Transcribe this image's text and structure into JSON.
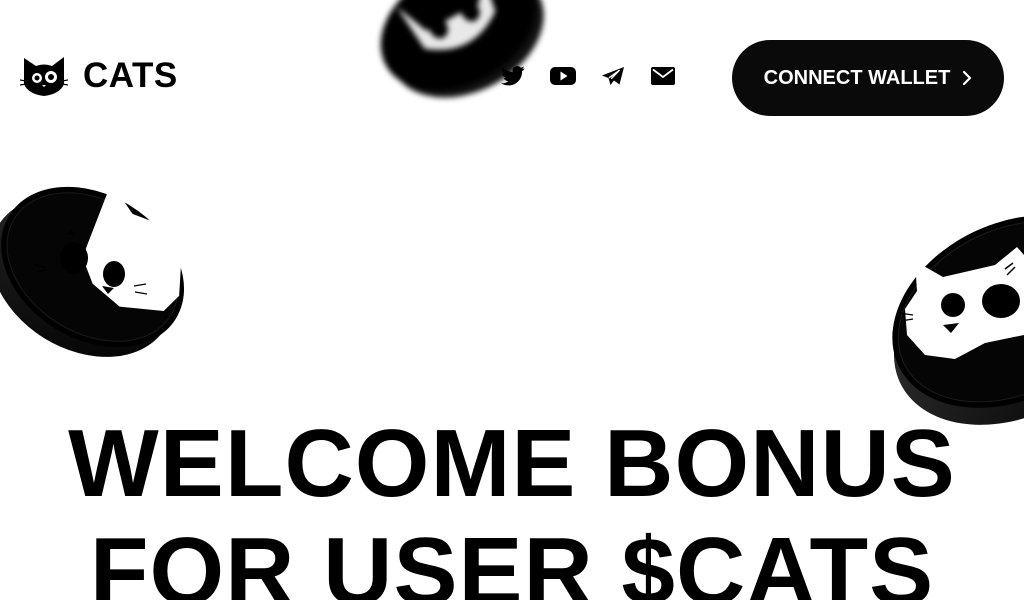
{
  "brand": {
    "name": "CATS",
    "logo_icon": "cat-face-icon"
  },
  "socials": [
    {
      "icon": "twitter-icon"
    },
    {
      "icon": "youtube-icon"
    },
    {
      "icon": "telegram-icon"
    },
    {
      "icon": "mail-icon"
    }
  ],
  "header": {
    "connect_label": "CONNECT WALLET",
    "connect_icon": "chevron-right-icon"
  },
  "hero": {
    "line1": "WELCOME BONUS",
    "line2": "FOR USER $CATS"
  },
  "colors": {
    "background": "#ffffff",
    "primary": "#000000",
    "button_bg": "#0a0a0a",
    "button_text": "#ffffff"
  }
}
